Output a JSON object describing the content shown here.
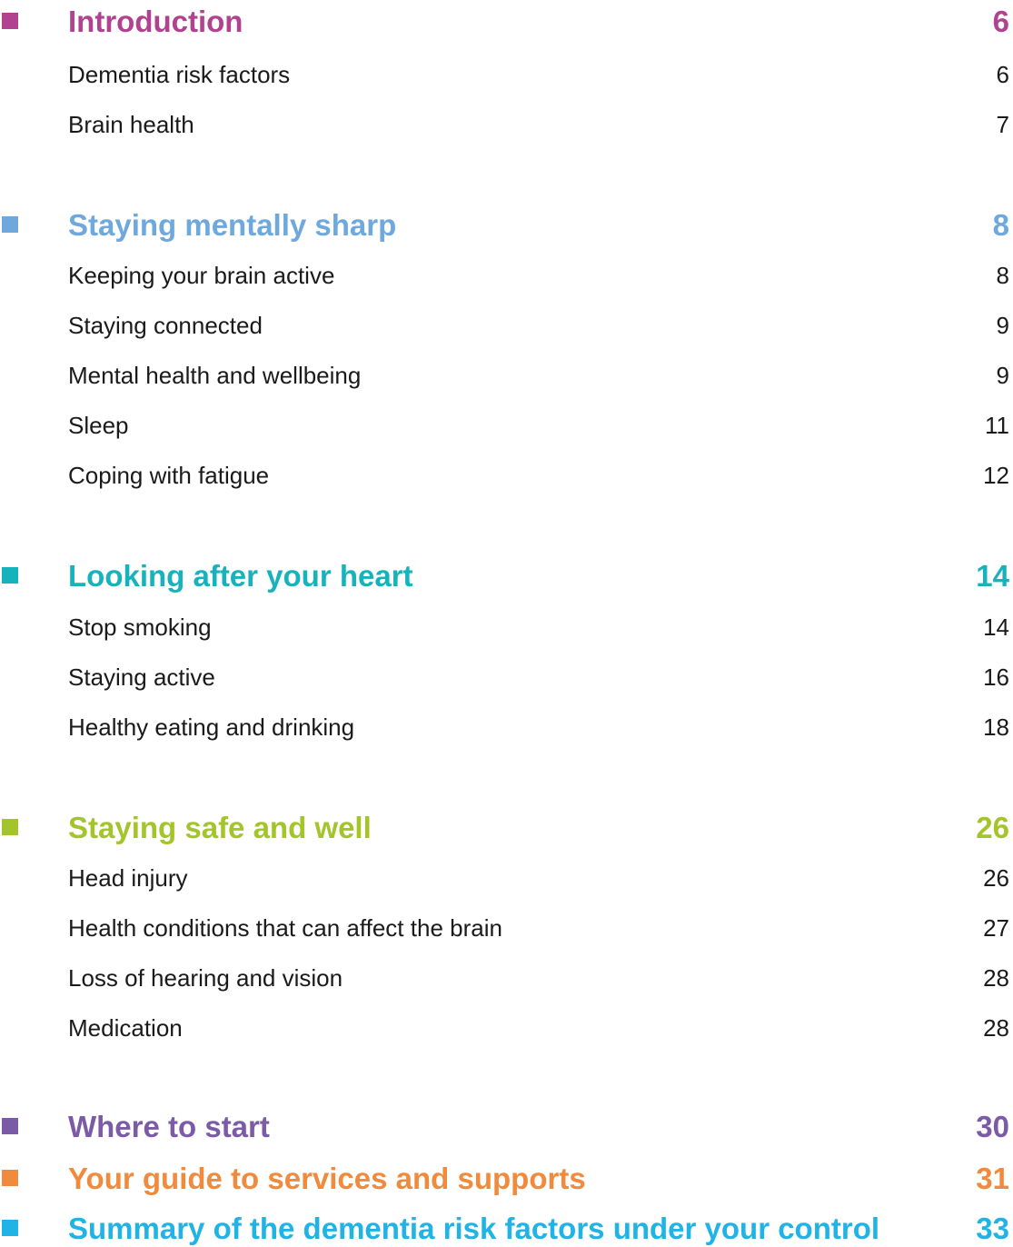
{
  "sections": [
    {
      "title": "Introduction",
      "page": "6",
      "color": "#b0428f",
      "items": [
        {
          "title": "Dementia risk factors",
          "page": "6"
        },
        {
          "title": "Brain health",
          "page": "7"
        }
      ]
    },
    {
      "title": "Staying mentally sharp",
      "page": "8",
      "color": "#6fa8dc",
      "items": [
        {
          "title": "Keeping your brain active",
          "page": "8"
        },
        {
          "title": "Staying connected",
          "page": "9"
        },
        {
          "title": "Mental health and wellbeing",
          "page": "9"
        },
        {
          "title": "Sleep",
          "page": "11"
        },
        {
          "title": "Coping with fatigue",
          "page": "12"
        }
      ]
    },
    {
      "title": "Looking after your heart",
      "page": "14",
      "color": "#17b3bd",
      "items": [
        {
          "title": "Stop smoking",
          "page": "14"
        },
        {
          "title": "Staying active",
          "page": "16"
        },
        {
          "title": "Healthy eating and drinking",
          "page": "18"
        }
      ]
    },
    {
      "title": "Staying safe and well",
      "page": "26",
      "color": "#a4c52a",
      "items": [
        {
          "title": "Head injury",
          "page": "26"
        },
        {
          "title": "Health conditions that can affect the brain",
          "page": "27"
        },
        {
          "title": "Loss of hearing and vision",
          "page": "28"
        },
        {
          "title": "Medication",
          "page": "28"
        }
      ]
    },
    {
      "title": "Where to start",
      "page": "30",
      "color": "#7b5aa6",
      "items": []
    },
    {
      "title": "Your guide to services and supports",
      "page": "31",
      "color": "#f08a3c",
      "items": []
    },
    {
      "title": "Summary of the dementia risk factors under your control",
      "page": "33",
      "color": "#1fb3e6",
      "items": []
    }
  ]
}
